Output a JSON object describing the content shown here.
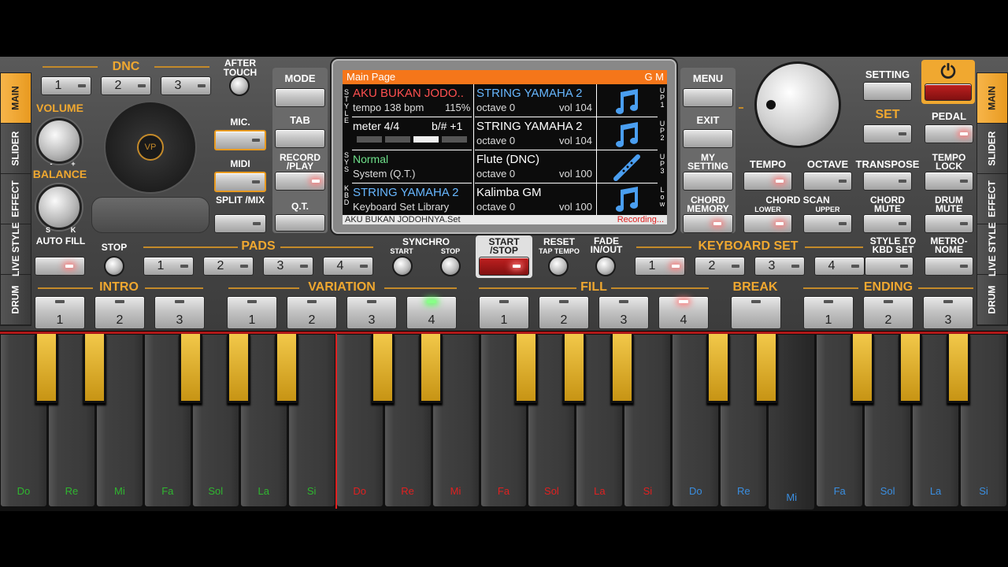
{
  "colors": {
    "accent": "#e89a20",
    "header": "#f5761a",
    "lcd_blue": "#67b7ff",
    "lcd_green": "#6ee08a",
    "recording": "#ff5050"
  },
  "left_tabs": [
    "MAIN",
    "SLIDER",
    "EFFECT",
    "LIVE STYLE",
    "DRUM"
  ],
  "right_tabs": [
    "MAIN",
    "SLIDER",
    "EFFECT",
    "LIVE STYLE",
    "DRUM"
  ],
  "dnc": {
    "label": "DNC",
    "buttons": [
      "1",
      "2",
      "3"
    ]
  },
  "after_touch": "AFTER TOUCH",
  "volume": {
    "label": "VOLUME",
    "minus": "-",
    "plus": "+"
  },
  "balance": {
    "label": "BALANCE",
    "s": "S",
    "k": "K"
  },
  "mic": "MIC.",
  "midi": "MIDI",
  "split_mix": "SPLIT /MIX",
  "mode": "MODE",
  "tab": "TAB",
  "record_play": "RECORD /PLAY",
  "qt": "Q.T.",
  "menu": "MENU",
  "exit": "EXIT",
  "my_setting": "MY SETTING",
  "chord_memory": "CHORD MEMORY",
  "setting": "SETTING",
  "power_icon": "power-icon",
  "set": "SET",
  "pedal": "PEDAL",
  "tempo": "TEMPO",
  "octave": "OCTAVE",
  "transpose": "TRANSPOSE",
  "tempo_lock": "TEMPO LOCK",
  "chord_scan": "CHORD SCAN",
  "lower": "LOWER",
  "upper": "UPPER",
  "chord_mute": "CHORD MUTE",
  "drum_mute": "DRUM MUTE",
  "auto_fill": "AUTO FILL",
  "stop": "STOP",
  "pads": {
    "label": "PADS",
    "buttons": [
      "1",
      "2",
      "3",
      "4"
    ]
  },
  "synchro": {
    "label": "SYNCHRO",
    "start": "START",
    "stop": "STOP"
  },
  "start_stop": "START /STOP",
  "reset": "RESET",
  "tap_tempo": "TAP TEMPO",
  "fade": "FADE IN/OUT",
  "keyboard_set": {
    "label": "KEYBOARD SET",
    "buttons": [
      "1",
      "2",
      "3",
      "4"
    ]
  },
  "style_to_kbd": "STYLE TO KBD SET",
  "metronome": "METRO- NOME",
  "intro": {
    "label": "INTRO",
    "buttons": [
      "1",
      "2",
      "3"
    ]
  },
  "variation": {
    "label": "VARIATION",
    "buttons": [
      "1",
      "2",
      "3",
      "4"
    ]
  },
  "fill": {
    "label": "FILL",
    "buttons": [
      "1",
      "2",
      "3",
      "4"
    ]
  },
  "break": "BREAK",
  "ending": {
    "label": "ENDING",
    "buttons": [
      "1",
      "2",
      "3"
    ]
  },
  "lcd": {
    "title": "Main Page",
    "gm": "G M",
    "song": "AKU BUKAN JODO..",
    "tempo": "tempo 138 bpm",
    "tempo_pct": "115%",
    "meter": "meter 4/4",
    "key": "b/# +1",
    "system_name": "Normal",
    "system_sub": "System (Q.T.)",
    "kbd_name": "STRING YAMAHA 2",
    "kbd_sub": "Keyboard Set Library",
    "up1": {
      "name": "STRING YAMAHA 2",
      "octave": "octave  0",
      "vol": "vol 104"
    },
    "up2": {
      "name": "STRING YAMAHA 2",
      "octave": "octave  0",
      "vol": "vol 104"
    },
    "up3": {
      "name": "Flute (DNC)",
      "octave": "octave  0",
      "vol": "vol 100"
    },
    "low": {
      "name": "Kalimba GM",
      "octave": "octave  0",
      "vol": "vol 100"
    },
    "footer_file": "AKU BUKAN JODOHNYA.Set",
    "footer_status": "Recording...",
    "side_style": [
      "S",
      "T",
      "Y",
      "L",
      "E"
    ],
    "side_sys": [
      "S",
      "Y",
      "S"
    ],
    "side_kbd": [
      "K",
      "B",
      "D"
    ],
    "side_up1": [
      "U",
      "P",
      "1"
    ],
    "side_up2": [
      "U",
      "P",
      "2"
    ],
    "side_up3": [
      "U",
      "P",
      "3"
    ],
    "side_low": [
      "L",
      "o",
      "w"
    ]
  },
  "keys": [
    {
      "n": "Do",
      "c": "#2fb62f"
    },
    {
      "n": "Re",
      "c": "#2fb62f"
    },
    {
      "n": "Mi",
      "c": "#2fb62f"
    },
    {
      "n": "Fa",
      "c": "#2fb62f"
    },
    {
      "n": "Sol",
      "c": "#2fb62f"
    },
    {
      "n": "La",
      "c": "#2fb62f"
    },
    {
      "n": "Si",
      "c": "#2fb62f"
    },
    {
      "n": "Do",
      "c": "#e02020"
    },
    {
      "n": "Re",
      "c": "#e02020"
    },
    {
      "n": "Mi",
      "c": "#e02020"
    },
    {
      "n": "Fa",
      "c": "#e02020"
    },
    {
      "n": "Sol",
      "c": "#e02020"
    },
    {
      "n": "La",
      "c": "#e02020"
    },
    {
      "n": "Si",
      "c": "#e02020"
    },
    {
      "n": "Do",
      "c": "#3a8ee0"
    },
    {
      "n": "Re",
      "c": "#3a8ee0"
    },
    {
      "n": "Mi",
      "c": "#3a8ee0"
    },
    {
      "n": "Fa",
      "c": "#3a8ee0"
    },
    {
      "n": "Sol",
      "c": "#3a8ee0"
    },
    {
      "n": "La",
      "c": "#3a8ee0"
    },
    {
      "n": "Si",
      "c": "#3a8ee0"
    }
  ]
}
